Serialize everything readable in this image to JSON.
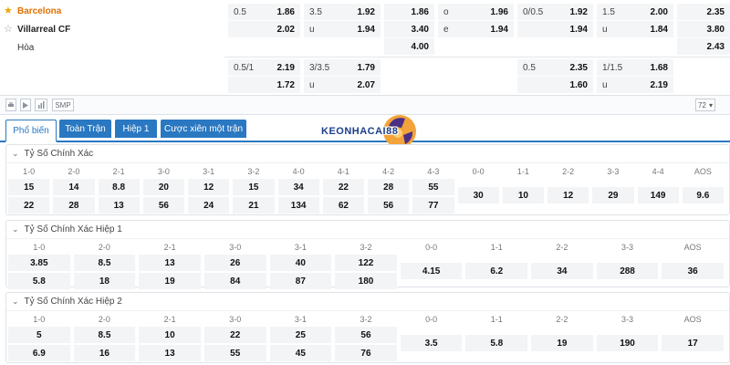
{
  "match": {
    "home_team": "Barcelona",
    "away_team": "Villarreal CF",
    "draw_label": "Hòa"
  },
  "top_odds": [
    [
      {
        "k": "0.5",
        "v": "1.86"
      },
      {
        "k": "3.5",
        "v": "1.92"
      },
      {
        "k": "",
        "v": "1.86"
      },
      {
        "k": "o",
        "v": "1.96"
      },
      {
        "k": "0/0.5",
        "v": "1.92"
      },
      {
        "k": "1.5",
        "v": "2.00"
      },
      {
        "k": "",
        "v": "2.35"
      }
    ],
    [
      {
        "k": "",
        "v": "2.02"
      },
      {
        "k": "u",
        "v": "1.94"
      },
      {
        "k": "",
        "v": "3.40"
      },
      {
        "k": "e",
        "v": "1.94"
      },
      {
        "k": "",
        "v": "1.94"
      },
      {
        "k": "u",
        "v": "1.84"
      },
      {
        "k": "",
        "v": "3.80"
      }
    ],
    [
      null,
      null,
      {
        "k": "",
        "v": "4.00"
      },
      null,
      null,
      null,
      {
        "k": "",
        "v": "2.43"
      }
    ],
    [
      {
        "k": "0.5/1",
        "v": "2.19"
      },
      {
        "k": "3/3.5",
        "v": "1.79"
      },
      null,
      null,
      {
        "k": "0.5",
        "v": "2.35"
      },
      {
        "k": "1/1.5",
        "v": "1.68"
      },
      null
    ],
    [
      {
        "k": "",
        "v": "1.72"
      },
      {
        "k": "u",
        "v": "2.07"
      },
      null,
      null,
      {
        "k": "",
        "v": "1.60"
      },
      {
        "k": "u",
        "v": "2.19"
      },
      null
    ]
  ],
  "toolbar": {
    "smp_label": "SMP",
    "count_value": "72"
  },
  "tabs": [
    {
      "label": "Phổ biến"
    },
    {
      "label": "Toàn Trận"
    },
    {
      "label": "Hiệp 1"
    },
    {
      "label": "Cược xiên một trận"
    }
  ],
  "logo_text": "KEONHACAI88",
  "sections": [
    {
      "title": "Tỷ Số Chính Xác",
      "headers": [
        "1-0",
        "2-0",
        "2-1",
        "3-0",
        "3-1",
        "3-2",
        "4-0",
        "4-1",
        "4-2",
        "4-3",
        "0-0",
        "1-1",
        "2-2",
        "3-3",
        "4-4",
        "AOS"
      ],
      "home_row": [
        "15",
        "14",
        "8.8",
        "20",
        "12",
        "15",
        "34",
        "22",
        "28",
        "55"
      ],
      "away_row": [
        "22",
        "28",
        "13",
        "56",
        "24",
        "21",
        "134",
        "62",
        "56",
        "77"
      ],
      "single_row": [
        "30",
        "10",
        "12",
        "29",
        "149",
        "9.6"
      ]
    },
    {
      "title": "Tỷ Số Chính Xác Hiệp 1",
      "headers": [
        "1-0",
        "2-0",
        "2-1",
        "3-0",
        "3-1",
        "3-2",
        "0-0",
        "1-1",
        "2-2",
        "3-3",
        "AOS"
      ],
      "home_row": [
        "3.85",
        "8.5",
        "13",
        "26",
        "40",
        "122"
      ],
      "away_row": [
        "5.8",
        "18",
        "19",
        "84",
        "87",
        "180"
      ],
      "single_row": [
        "4.15",
        "6.2",
        "34",
        "288",
        "36"
      ]
    },
    {
      "title": "Tỷ Số Chính Xác Hiệp 2",
      "headers": [
        "1-0",
        "2-0",
        "2-1",
        "3-0",
        "3-1",
        "3-2",
        "0-0",
        "1-1",
        "2-2",
        "3-3",
        "AOS"
      ],
      "home_row": [
        "5",
        "8.5",
        "10",
        "22",
        "25",
        "56"
      ],
      "away_row": [
        "6.9",
        "16",
        "13",
        "55",
        "45",
        "76"
      ],
      "single_row": [
        "3.5",
        "5.8",
        "19",
        "190",
        "17"
      ]
    }
  ],
  "colors": {
    "accent": "#2a78c2",
    "home_team": "#e07000",
    "star": "#f0a500"
  }
}
